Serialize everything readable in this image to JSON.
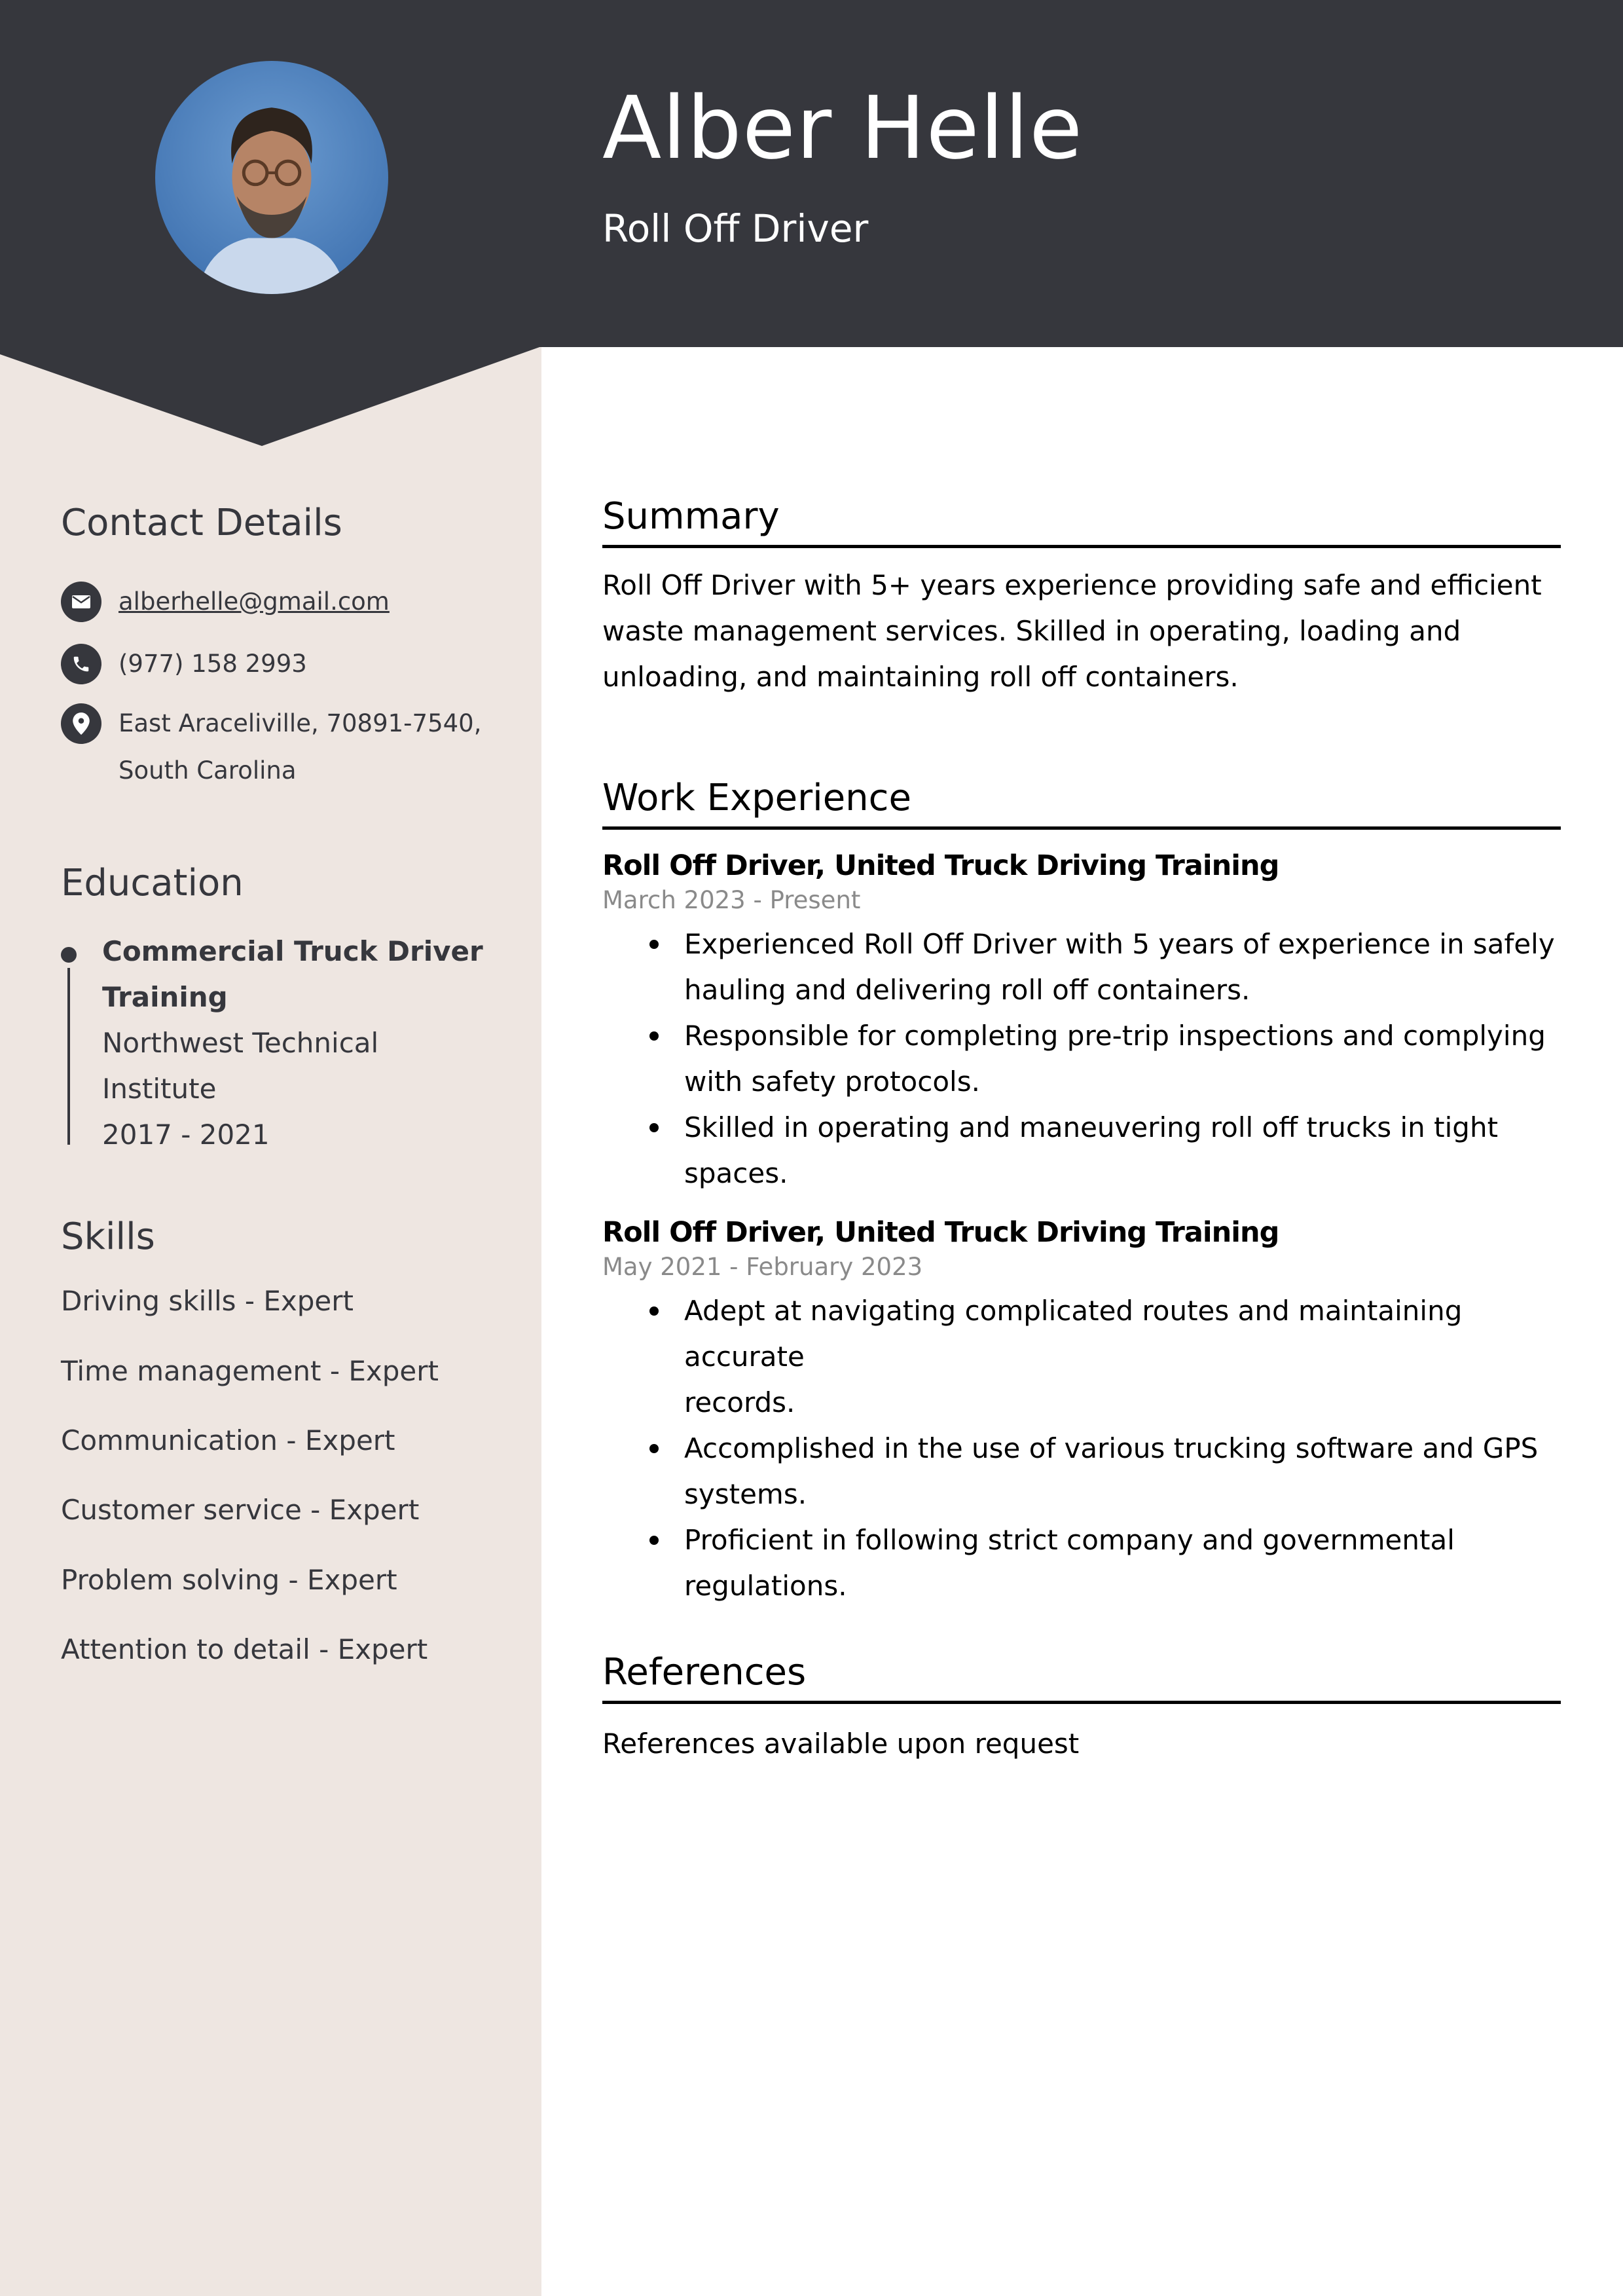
{
  "header": {
    "name": "Alber Helle",
    "title": "Roll Off Driver"
  },
  "colors": {
    "header_bg": "#36373d",
    "sidebar_bg": "#eee6e1",
    "text_dark": "#36373d",
    "date_gray": "#8a8a8a"
  },
  "sidebar": {
    "contact": {
      "heading": "Contact Details",
      "items": [
        {
          "icon": "envelope-icon",
          "text": "alberhelle@gmail.com"
        },
        {
          "icon": "phone-icon",
          "text": "(977) 158 2993"
        },
        {
          "icon": "location-pin-icon",
          "line1": "East Araceliville, 70891-7540,",
          "line2": "South Carolina"
        }
      ]
    },
    "education": {
      "heading": "Education",
      "items": [
        {
          "degree_line1": "Commercial Truck Driver",
          "degree_line2": "Training",
          "school_line1": "Northwest Technical",
          "school_line2": "Institute",
          "years": "2017 - 2021"
        }
      ]
    },
    "skills": {
      "heading": "Skills",
      "items": [
        "Driving skills - Expert",
        "Time management - Expert",
        "Communication - Expert",
        "Customer service - Expert",
        "Problem solving - Expert",
        "Attention to detail - Expert"
      ]
    }
  },
  "main": {
    "summary": {
      "heading": "Summary",
      "lines": [
        "Roll Off Driver with 5+ years experience providing safe and efficient",
        "waste management services. Skilled in operating, loading and",
        "unloading, and maintaining roll off containers."
      ]
    },
    "work": {
      "heading": "Work Experience",
      "jobs": [
        {
          "title": "Roll Off Driver, United Truck Driving Training",
          "dates": "March 2023 - Present",
          "bullets": [
            [
              "Experienced Roll Off Driver with 5 years of experience in safely",
              "hauling and delivering roll off containers."
            ],
            [
              "Responsible for completing pre-trip inspections and complying",
              "with safety protocols."
            ],
            [
              "Skilled in operating and maneuvering roll off trucks in tight",
              "spaces."
            ]
          ]
        },
        {
          "title": "Roll Off Driver, United Truck Driving Training",
          "dates": "May 2021 - February 2023",
          "bullets": [
            [
              "Adept at navigating complicated routes and maintaining accurate",
              "records."
            ],
            [
              "Accomplished in the use of various trucking software and GPS",
              "systems."
            ],
            [
              "Proficient in following strict company and governmental",
              "regulations."
            ]
          ]
        }
      ]
    },
    "references": {
      "heading": "References",
      "text": "References available upon request"
    }
  }
}
